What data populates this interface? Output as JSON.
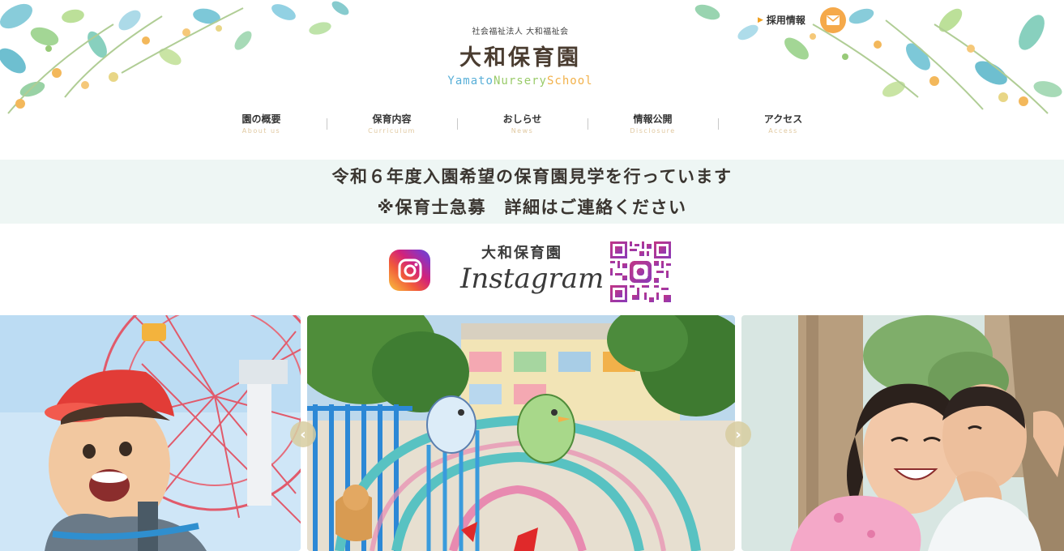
{
  "header": {
    "corp_name": "社会福祉法人 大和福祉会",
    "site_name": "大和保育園",
    "site_name_en": [
      "Yamato",
      " Nursery",
      " School"
    ],
    "site_name_en_colors": [
      "#5ab0d8",
      "#9acb6a",
      "#f2b14a"
    ],
    "recruit_label": "採用情報",
    "recruit_arrow": "▶",
    "mail_icon": "envelope-icon"
  },
  "nav": {
    "items": [
      {
        "label": "園の概要",
        "sub": "About us"
      },
      {
        "label": "保育内容",
        "sub": "Curriculum"
      },
      {
        "label": "おしらせ",
        "sub": "News"
      },
      {
        "label": "情報公開",
        "sub": "Disclosure"
      },
      {
        "label": "アクセス",
        "sub": "Access"
      }
    ]
  },
  "announcement": {
    "line1": "令和６年度入園希望の保育園見学を行っています",
    "line2": "※保育士急募　詳細はご連絡ください",
    "background": "#eef6f4"
  },
  "instagram": {
    "title_jp": "大和保育園",
    "title_en": "Instagram",
    "icon": "instagram-icon",
    "qr_icon": "qr-code-icon"
  },
  "slider": {
    "prev_label": "‹",
    "next_label": "›",
    "slides": [
      {
        "subject": "boy-ferris-wheel-photo"
      },
      {
        "subject": "playground-arch-photo"
      },
      {
        "subject": "children-laughing-photo"
      }
    ]
  },
  "colors": {
    "accent_orange": "#f5a94a",
    "nav_sub": "#e0c8a0",
    "text_dark": "#3a3530"
  }
}
